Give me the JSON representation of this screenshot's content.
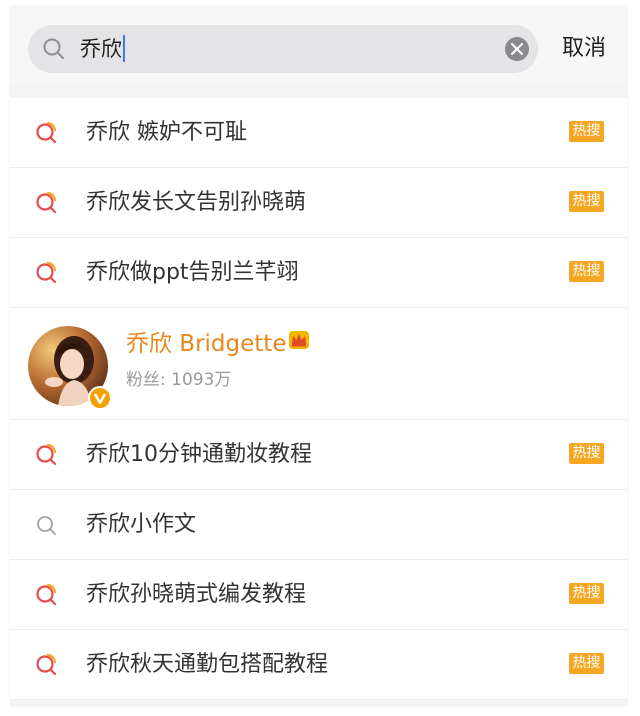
{
  "search": {
    "query": "乔欣",
    "cancel_label": "取消"
  },
  "suggestions_top": [
    {
      "text": "乔欣 嫉妒不可耻",
      "badge": "热搜",
      "icon": "hot-search-icon"
    },
    {
      "text": "乔欣发长文告别孙晓萌",
      "badge": "热搜",
      "icon": "hot-search-icon"
    },
    {
      "text": "乔欣做ppt告别兰芊翊",
      "badge": "热搜",
      "icon": "hot-search-icon"
    }
  ],
  "user_card": {
    "name": "乔欣 Bridgette",
    "fans": "粉丝: 1093万",
    "badge_icon": "crown-icon",
    "verified_icon": "verified-v-icon"
  },
  "suggestions_bottom": [
    {
      "text": "乔欣10分钟通勤妆教程",
      "badge": "热搜",
      "icon": "hot-search-icon"
    },
    {
      "text": "乔欣小作文",
      "badge": "",
      "icon": "search-icon"
    },
    {
      "text": "乔欣孙晓萌式编发教程",
      "badge": "热搜",
      "icon": "hot-search-icon"
    },
    {
      "text": "乔欣秋天通勤包搭配教程",
      "badge": "热搜",
      "icon": "hot-search-icon"
    }
  ],
  "colors": {
    "hot_badge": "#f5a623",
    "accent_name": "#e9861b",
    "caret": "#3a7bf5",
    "hot_icon_red": "#e94b4b",
    "hot_icon_orange": "#f5a623"
  }
}
